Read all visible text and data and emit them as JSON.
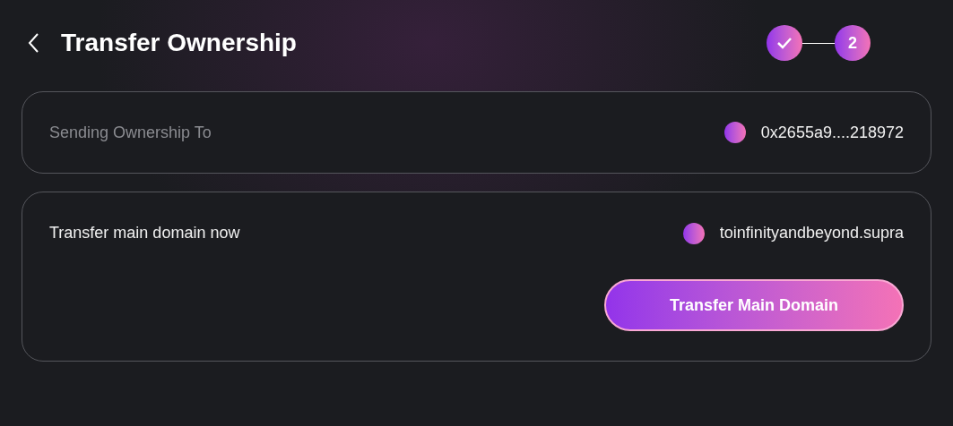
{
  "header": {
    "title": "Transfer Ownership"
  },
  "steps": [
    {
      "completed": true
    },
    {
      "label": "2",
      "completed": false
    }
  ],
  "recipient": {
    "label": "Sending Ownership To",
    "address": "0x2655a9....218972"
  },
  "main_domain": {
    "label": "Transfer main domain now",
    "domain": "toinfinityandbeyond.supra",
    "button": "Transfer Main Domain"
  }
}
